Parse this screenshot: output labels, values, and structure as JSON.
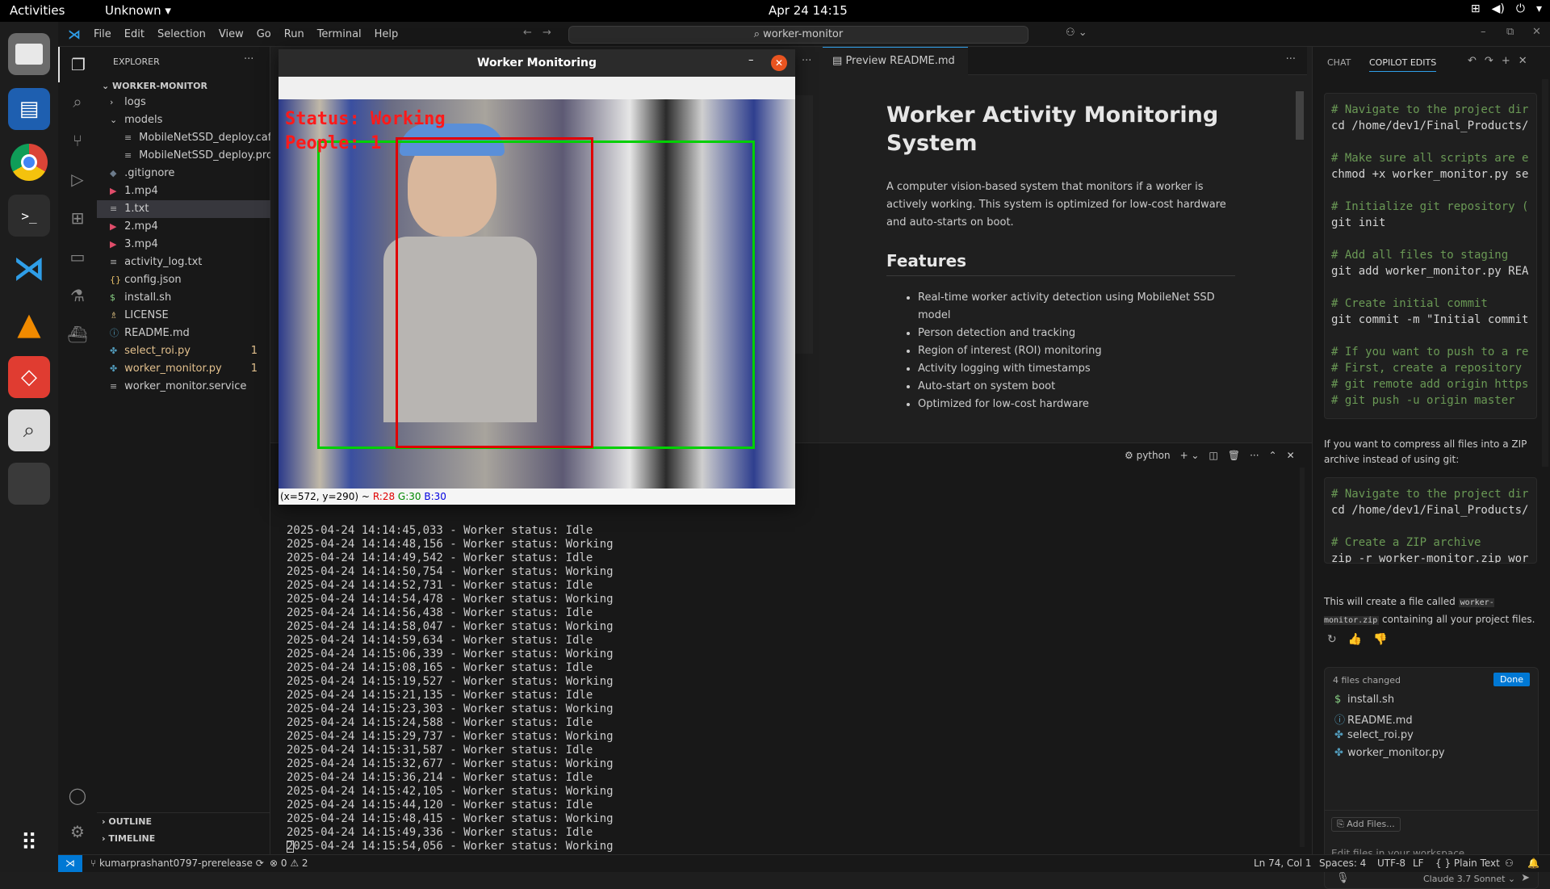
{
  "topbar": {
    "activities": "Activities",
    "app_menu": "Unknown ▾",
    "clock": "Apr 24  14:15"
  },
  "menu": [
    "File",
    "Edit",
    "Selection",
    "View",
    "Go",
    "Run",
    "Terminal",
    "Help"
  ],
  "search": "⌕ worker-monitor",
  "explorer": {
    "header": "EXPLORER",
    "root": "WORKER-MONITOR",
    "outline": "OUTLINE",
    "timeline": "TIMELINE",
    "items": [
      {
        "name": "logs",
        "type": "folder",
        "indent": 1,
        "icon": "›"
      },
      {
        "name": "models",
        "type": "folder",
        "indent": 1,
        "icon": "⌄"
      },
      {
        "name": "MobileNetSSD_deploy.caff...",
        "type": "file",
        "indent": 2,
        "icon": "≡"
      },
      {
        "name": "MobileNetSSD_deploy.pro...",
        "type": "file",
        "indent": 2,
        "icon": "≡"
      },
      {
        "name": ".gitignore",
        "type": "file",
        "indent": 1,
        "icon": "◆"
      },
      {
        "name": "1.mp4",
        "type": "file",
        "indent": 1,
        "icon": "▶"
      },
      {
        "name": "1.txt",
        "type": "file",
        "indent": 1,
        "icon": "≡",
        "selected": true
      },
      {
        "name": "2.mp4",
        "type": "file",
        "indent": 1,
        "icon": "▶"
      },
      {
        "name": "3.mp4",
        "type": "file",
        "indent": 1,
        "icon": "▶"
      },
      {
        "name": "activity_log.txt",
        "type": "file",
        "indent": 1,
        "icon": "≡"
      },
      {
        "name": "config.json",
        "type": "file",
        "indent": 1,
        "icon": "{}"
      },
      {
        "name": "install.sh",
        "type": "file",
        "indent": 1,
        "icon": "$"
      },
      {
        "name": "LICENSE",
        "type": "file",
        "indent": 1,
        "icon": "♗"
      },
      {
        "name": "README.md",
        "type": "file",
        "indent": 1,
        "icon": "ⓘ"
      },
      {
        "name": "select_roi.py",
        "type": "file",
        "indent": 1,
        "icon": "✤",
        "badge": "1",
        "modified": true
      },
      {
        "name": "worker_monitor.py",
        "type": "file",
        "indent": 1,
        "icon": "✤",
        "badge": "1",
        "modified": true
      },
      {
        "name": "worker_monitor.service",
        "type": "file",
        "indent": 1,
        "icon": "≡"
      }
    ]
  },
  "cvwindow": {
    "title": "Worker Monitoring",
    "status": "Status: Working",
    "people": "People: 1",
    "coords": "(x=572, y=290) ~",
    "r": "R:28",
    "g": "G:30",
    "b": "B:30"
  },
  "preview_tab": "Preview README.md",
  "readme": {
    "title": "Worker Activity Monitoring System",
    "intro": "A computer vision-based system that monitors if a worker is actively working. This system is optimized for low-cost hardware and auto-starts on boot.",
    "features_heading": "Features",
    "features": [
      "Real-time worker activity detection using MobileNet SSD model",
      "Person detection and tracking",
      "Region of interest (ROI) monitoring",
      "Activity logging with timestamps",
      "Auto-start on system boot",
      "Optimized for low-cost hardware"
    ]
  },
  "terminal": {
    "label": "python",
    "lines": [
      "2025-04-24 14:14:45,033 - Worker status: Idle",
      "2025-04-24 14:14:48,156 - Worker status: Working",
      "2025-04-24 14:14:49,542 - Worker status: Idle",
      "2025-04-24 14:14:50,754 - Worker status: Working",
      "2025-04-24 14:14:52,731 - Worker status: Idle",
      "2025-04-24 14:14:54,478 - Worker status: Working",
      "2025-04-24 14:14:56,438 - Worker status: Idle",
      "2025-04-24 14:14:58,047 - Worker status: Working",
      "2025-04-24 14:14:59,634 - Worker status: Idle",
      "2025-04-24 14:15:06,339 - Worker status: Working",
      "2025-04-24 14:15:08,165 - Worker status: Idle",
      "2025-04-24 14:15:19,527 - Worker status: Working",
      "2025-04-24 14:15:21,135 - Worker status: Idle",
      "2025-04-24 14:15:23,303 - Worker status: Working",
      "2025-04-24 14:15:24,588 - Worker status: Idle",
      "2025-04-24 14:15:29,737 - Worker status: Working",
      "2025-04-24 14:15:31,587 - Worker status: Idle",
      "2025-04-24 14:15:32,677 - Worker status: Working",
      "2025-04-24 14:15:36,214 - Worker status: Idle",
      "2025-04-24 14:15:42,105 - Worker status: Working",
      "2025-04-24 14:15:44,120 - Worker status: Idle",
      "2025-04-24 14:15:48,415 - Worker status: Working",
      "2025-04-24 14:15:49,336 - Worker status: Idle",
      "2025-04-24 14:15:54,056 - Worker status: Working"
    ]
  },
  "chat": {
    "tab_chat": "CHAT",
    "tab_edits": "COPILOT EDITS",
    "code1": [
      "# Navigate to the project dir",
      "cd /home/dev1/Final_Products/",
      "",
      "# Make sure all scripts are e",
      "chmod +x worker_monitor.py se",
      "",
      "# Initialize git repository (",
      "git init",
      "",
      "# Add all files to staging",
      "git add worker_monitor.py REA",
      "",
      "# Create initial commit",
      "git commit -m \"Initial commit",
      "",
      "# If you want to push to a re",
      "# First, create a repository ",
      "# git remote add origin https",
      "# git push -u origin master  "
    ],
    "para1": "If you want to compress all files into a ZIP archive instead of using git:",
    "code2": [
      "# Navigate to the project dir",
      "cd /home/dev1/Final_Products/",
      "",
      "# Create a ZIP archive",
      "zip -r worker-monitor.zip wor"
    ],
    "para2_a": "This will create a file called ",
    "para2_code": "worker-monitor.zip",
    "para2_b": " containing all your project files.",
    "changed": "4 files changed",
    "done": "Done",
    "files": [
      {
        "icon": "$",
        "name": "install.sh"
      },
      {
        "icon": "ⓘ",
        "name": "README.md"
      },
      {
        "icon": "✤",
        "name": "select_roi.py"
      },
      {
        "icon": "✤",
        "name": "worker_monitor.py"
      }
    ],
    "add_files": "⎘ Add Files...",
    "input_placeholder": "Edit files in your workspace",
    "model": "Claude 3.7 Sonnet ⌄"
  },
  "status": {
    "branch": "kumarprashant0797-prerelease",
    "problems": "⊗ 0 ⚠ 2",
    "pos": "Ln 74, Col 1",
    "spaces": "Spaces: 4",
    "enc": "UTF-8",
    "eol": "LF",
    "lang": "{ } Plain Text"
  }
}
